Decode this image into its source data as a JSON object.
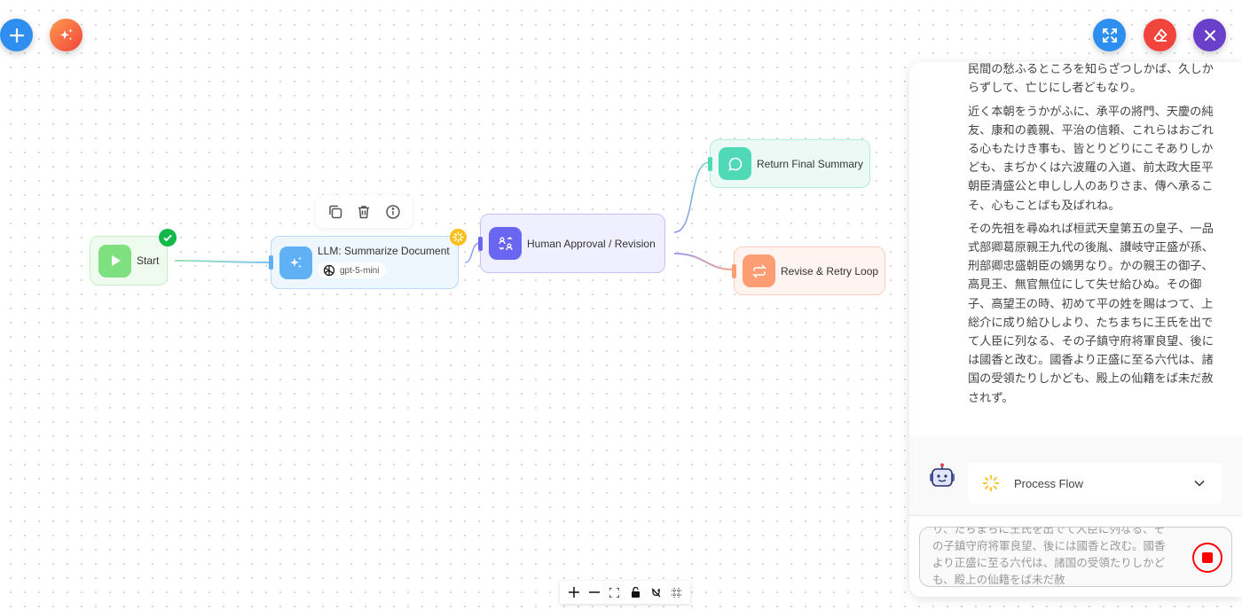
{
  "toolbar_left": {
    "add_icon": "plus-icon",
    "ai_icon": "sparkles-icon"
  },
  "toolbar_right": {
    "expand_icon": "expand-icon",
    "eraser_icon": "eraser-icon",
    "close_icon": "close-icon"
  },
  "colors": {
    "blue": "#2f8ff0",
    "red": "#f0443c",
    "purple": "#6a3fc9",
    "start": "#7ee07f",
    "llm": "#5fb0f5",
    "human": "#6b66f2",
    "return": "#4fd9b6",
    "revise": "#fd9d74",
    "stop": "#ff0000"
  },
  "nodes": {
    "start": {
      "label": "Start",
      "status": "completed"
    },
    "llm": {
      "label": "LLM: Summarize Document",
      "model": "gpt-5-mini",
      "status": "running"
    },
    "human": {
      "label": "Human Approval / Revision"
    },
    "return": {
      "label": "Return Final Summary"
    },
    "revise": {
      "label": "Revise & Retry Loop"
    }
  },
  "node_toolbar": {
    "items": [
      "copy-icon",
      "trash-icon",
      "info-icon"
    ]
  },
  "chat": {
    "paragraphs": [
      "を思ひいれず、天下の乱れむ事を悟らずして、民間の愁ふるところを知らざつしかば、久しからずして、亡じにし者どもなり。",
      "近く本朝をうかがふに、承平の將門、天慶の純友、康和の義親、平治の信頼、これらはおごれる心もたけき事も、皆とりどりにこそありしかども、まぢかくは六波羅の入道、前太政大臣平朝臣清盛公と申しし人のありさま、傳へ承るこそ、心もことばも及ばれね。",
      "その先祖を尋ぬれば桓武天皇第五の皇子、一品式部卿葛原親王九代の後胤、讃岐守正盛が孫、刑部卿忠盛朝臣の嫡男なり。かの親王の御子、高見王、無官無位にして失せ給ひぬ。その御子、高望王の時、初めて平の姓を賜はつて、上総介に成り給ひしより、たちまちに王氏を出でて人臣に列なる、その子鎮守府将軍良望、後には國香と改む。國香より正盛に至る六代は、諸国の受領たりしかども、殿上の仙籍をば未だ赦されず。"
    ],
    "flow_label": "Process Flow",
    "input_value": "り、たちまちに王氏を出でて人臣に列なる、その子鎮守府将軍良望、後には國香と改む。國香より正盛に至る六代は、諸国の受領たりしかども、殿上の仙籍をば未だ赦"
  },
  "canvas_controls": [
    "zoom-in-icon",
    "zoom-out-icon",
    "fit-view-icon",
    "lock-icon",
    "magnet-icon",
    "grid-icon"
  ]
}
